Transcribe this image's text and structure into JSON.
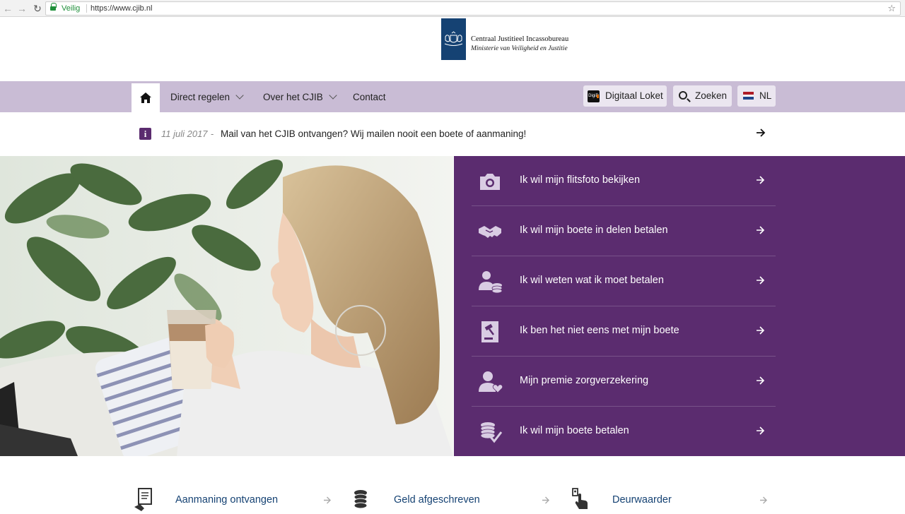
{
  "browser": {
    "secure_label": "Veilig",
    "url": "https://www.cjib.nl"
  },
  "logo": {
    "line1": "Centraal Justitieel Incassobureau",
    "line2": "Ministerie van Veiligheid en Justitie"
  },
  "nav": {
    "items": [
      {
        "label": "Direct regelen"
      },
      {
        "label": "Over het CJIB"
      },
      {
        "label": "Contact"
      }
    ],
    "digid_badge": "DigiD",
    "digitaal_loket": "Digitaal Loket",
    "zoeken": "Zoeken",
    "language": "NL"
  },
  "notice": {
    "date": "11 juli 2017",
    "separator": "-",
    "text": "Mail van het CJIB ontvangen? Wij mailen nooit een boete of aanmaning!"
  },
  "actions": [
    {
      "label": "Ik wil mijn flitsfoto bekijken",
      "icon": "camera-icon"
    },
    {
      "label": "Ik wil mijn boete in delen betalen",
      "icon": "handshake-icon"
    },
    {
      "label": "Ik wil weten wat ik moet betalen",
      "icon": "person-coins-icon"
    },
    {
      "label": "Ik ben het niet eens met mijn boete",
      "icon": "gavel-document-icon"
    },
    {
      "label": "Mijn premie zorgverzekering",
      "icon": "person-heart-icon"
    },
    {
      "label": "Ik wil mijn boete betalen",
      "icon": "coins-check-icon"
    }
  ],
  "bottom_links": [
    {
      "label": "Aanmaning ontvangen",
      "icon": "document-euro-icon"
    },
    {
      "label": "Geld afgeschreven",
      "icon": "coin-stack-icon"
    },
    {
      "label": "Deurwaarder",
      "icon": "hand-doorbell-icon"
    }
  ],
  "colors": {
    "purple": "#5b2c6f",
    "nav_bg": "#c9bcd5",
    "rijksblauw": "#154273",
    "secure_green": "#1f8f3a"
  }
}
